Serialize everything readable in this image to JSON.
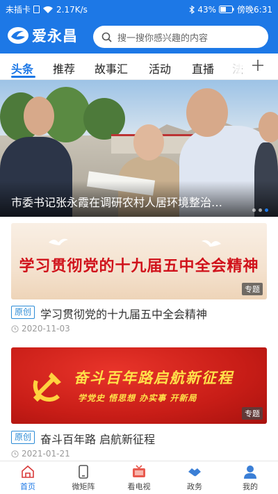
{
  "status_bar": {
    "sim": "未插卡",
    "speed": "2.17K/s",
    "battery": "43%",
    "time": "傍晚6:31"
  },
  "header": {
    "app_name": "爱永昌",
    "search_placeholder": "搜一搜你感兴趣的内容"
  },
  "tabs": [
    {
      "label": "头条",
      "active": true
    },
    {
      "label": "推荐"
    },
    {
      "label": "故事汇"
    },
    {
      "label": "活动"
    },
    {
      "label": "直播"
    },
    {
      "label": "法"
    }
  ],
  "hero": {
    "caption": "市委书记张永霞在调研农村人居环境整治…"
  },
  "items": [
    {
      "banner_text": "学习贯彻党的十九届五中全会精神",
      "tag": "专题",
      "badge": "原创",
      "title": "学习贯彻党的十九届五中全会精神",
      "date": "2020-11-03"
    },
    {
      "banner_text": "奋斗百年路启航新征程",
      "banner_sub": "学党史 悟思想 办实事 开新局",
      "tag": "专题",
      "badge": "原创",
      "title": "奋斗百年路  启航新征程",
      "date": "2021-01-21"
    }
  ],
  "bottom_nav": [
    {
      "label": "首页",
      "icon": "home-icon",
      "active": true
    },
    {
      "label": "微矩阵",
      "icon": "phone-icon"
    },
    {
      "label": "看电视",
      "icon": "tv-icon"
    },
    {
      "label": "政务",
      "icon": "handshake-icon"
    },
    {
      "label": "我的",
      "icon": "user-icon"
    }
  ],
  "colors": {
    "accent": "#1d78e6",
    "badge": "#2b8bd6"
  }
}
